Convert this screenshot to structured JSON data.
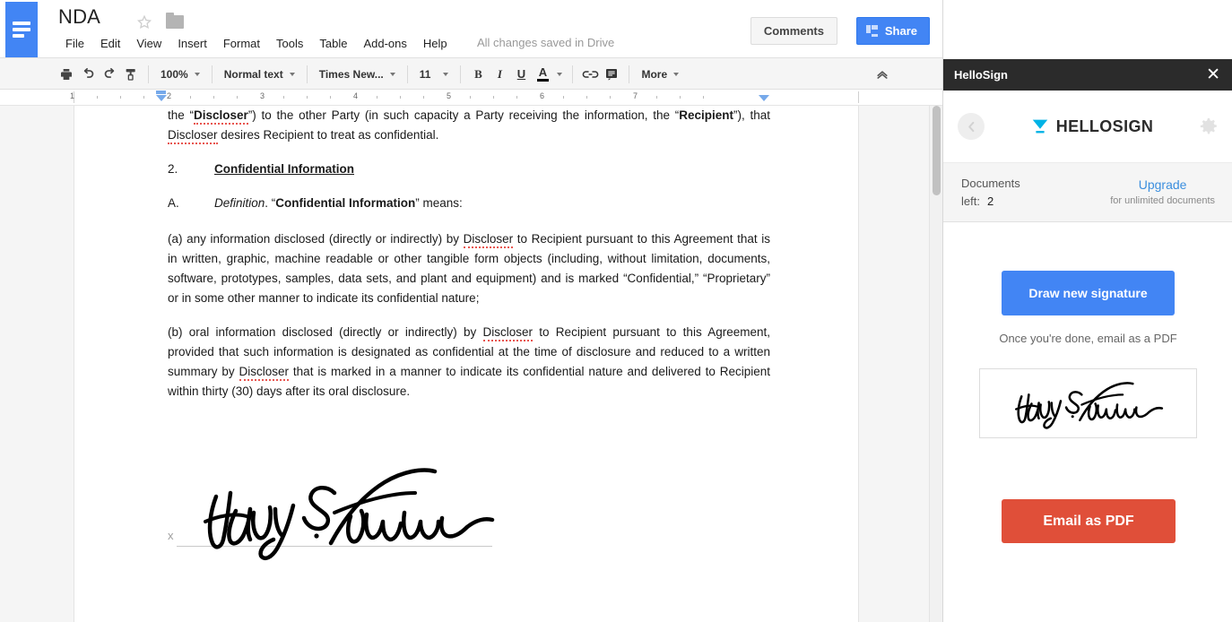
{
  "docs": {
    "title": "NDA",
    "logo_icon": "docs-logo-icon",
    "star_icon": "star-icon",
    "folder_icon": "folder-icon",
    "menu": [
      "File",
      "Edit",
      "View",
      "Insert",
      "Format",
      "Tools",
      "Table",
      "Add-ons",
      "Help"
    ],
    "save_state": "All changes saved in Drive",
    "comments_label": "Comments",
    "share_label": "Share",
    "toolbar": {
      "print_icon": "print-icon",
      "undo_icon": "undo-icon",
      "redo_icon": "redo-icon",
      "paint_format_icon": "paint-format-icon",
      "zoom_value": "100%",
      "style_value": "Normal text",
      "font_value": "Times New...",
      "size_value": "11",
      "bold_label": "B",
      "italic_label": "I",
      "underline_label": "U",
      "text_color_label": "A",
      "link_icon": "link-icon",
      "comment_icon": "add-comment-icon",
      "more_label": "More",
      "collapse_icon": "chevron-up-icon"
    },
    "ruler": {
      "numbers": [
        "1",
        "2",
        "3",
        "4",
        "5",
        "6",
        "7"
      ]
    }
  },
  "document": {
    "para_intro_a": "the “",
    "para_intro_disc": "Discloser",
    "para_intro_b": "”) to the other Party (in such capacity a Party receiving the information, the “",
    "para_intro_recip": "Recipient",
    "para_intro_c": "”), that ",
    "para_intro_disc2": "Discloser",
    "para_intro_d": " desires Recipient to treat as confidential.",
    "section_number": "2.",
    "section_title": "Confidential Information",
    "defn_letter": "A.",
    "defn_word": "Definition",
    "defn_sep": ". “",
    "defn_term": "Confidential Information",
    "defn_tail": "” means:",
    "para_a_1": "(a) any information disclosed (directly or indirectly) by ",
    "para_a_disc": "Discloser",
    "para_a_2": " to Recipient pursuant to this Agreement that is in written, graphic, machine readable or other tangible form objects (including, without limitation, documents, software, prototypes, samples, data sets, and plant and equipment) and is marked “Confidential,” “Proprietary” or in some other manner to indicate its confidential nature;",
    "para_b_1": "(b) oral information disclosed (directly or indirectly) by ",
    "para_b_disc": "Discloser",
    "para_b_2": " to Recipient pursuant to this Agreement, provided that such information is designated as confidential at the time of disclosure and reduced to a written summary by ",
    "para_b_disc2": "Discloser",
    "para_b_3": " that is marked in a manner to indicate its confidential nature and delivered to Recipient within thirty (30) days after its oral disclosure.",
    "signature_x": "x",
    "signature_name": "Harry S. Truman"
  },
  "hellosign": {
    "panel_title": "HelloSign",
    "close_icon": "close-icon",
    "back_icon": "chevron-left-icon",
    "logo_text": "HELLOSIGN",
    "logo_icon": "hellosign-funnel-icon",
    "gear_icon": "gear-icon",
    "documents_label": "Documents",
    "documents_left_label": "left:",
    "documents_left_value": "2",
    "upgrade_label": "Upgrade",
    "upgrade_sub": "for unlimited documents",
    "draw_button": "Draw new signature",
    "hint": "Once you're done, email as a PDF",
    "saved_signature_name": "Harry S. Truman",
    "email_button": "Email as PDF"
  },
  "colors": {
    "google_blue": "#4285f4",
    "hellosign_blue": "#00b3e6",
    "email_red": "#e04f39",
    "panel_dark": "#2b2b2b",
    "spellcheck_red": "#e8554f"
  }
}
